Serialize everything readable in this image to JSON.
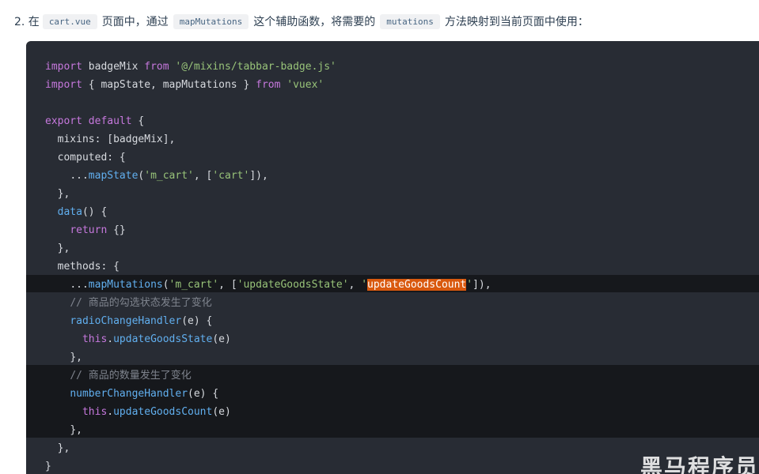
{
  "step": {
    "number": "2. 在",
    "file_code": "cart.vue",
    "text1": "页面中，通过",
    "helper_code": "mapMutations",
    "text2": "这个辅助函数，将需要的",
    "mutations_code": "mutations",
    "text3": "方法映射到当前页面中使用："
  },
  "code": {
    "l1_kw": "import",
    "l1_name": " badgeMix ",
    "l1_from": "from",
    "l1_path": " '@/mixins/tabbar-badge.js'",
    "l2_kw": "import",
    "l2_names": " { mapState, mapMutations } ",
    "l2_from": "from",
    "l2_path": " 'vuex'",
    "l4_kw": "export default",
    "l4_brace": " {",
    "l5_key": "mixins",
    "l5_rest": ": [badgeMix],",
    "l6_key": "computed",
    "l6_rest": ": {",
    "l7_spread": "...",
    "l7_fn": "mapState",
    "l7_a1": "'m_cart'",
    "l7_mid": ", [",
    "l7_a2": "'cart'",
    "l7_end": "]),",
    "l8": "},",
    "l9_fn": "data",
    "l9_rest": "() {",
    "l10_kw": "return",
    "l10_rest": " {}",
    "l11": "},",
    "l12_key": "methods",
    "l12_rest": ": {",
    "l13_spread": "...",
    "l13_fn": "mapMutations",
    "l13_a1": "'m_cart'",
    "l13_mid": ", [",
    "l13_a2": "'updateGoodsState'",
    "l13_sep": ", ",
    "l13_q1": "'",
    "l13_sel": "updateGoodsCount",
    "l13_q2": "'",
    "l13_end": "]),",
    "l14_comment": "// 商品的勾选状态发生了变化",
    "l15_fn": "radioChangeHandler",
    "l15_rest": "(e) {",
    "l16_this": "this",
    "l16_dot": ".",
    "l16_fn": "updateGoodsState",
    "l16_rest": "(e)",
    "l17": "},",
    "l18_comment": "// 商品的数量发生了变化",
    "l19_fn": "numberChangeHandler",
    "l19_rest": "(e) {",
    "l20_this": "this",
    "l20_dot": ".",
    "l20_fn": "updateGoodsCount",
    "l20_rest": "(e)",
    "l21": "},",
    "l22": "},",
    "l23": "}"
  },
  "watermark": "黑马程序员"
}
